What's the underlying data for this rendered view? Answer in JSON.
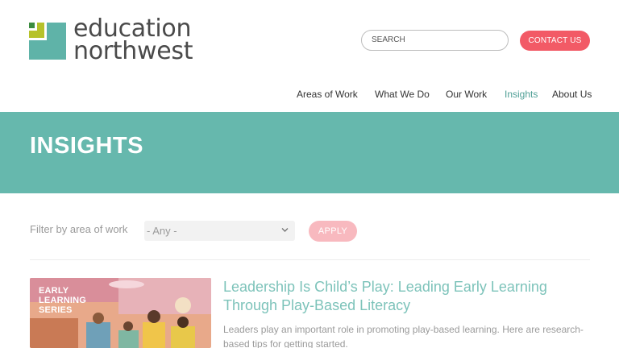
{
  "logo": {
    "line1": "education",
    "line2": "northwest"
  },
  "header": {
    "search_placeholder": "SEARCH",
    "contact_label": "CONTACT US"
  },
  "nav": {
    "items": [
      {
        "label": "Areas of Work"
      },
      {
        "label": "What We Do"
      },
      {
        "label": "Our Work"
      },
      {
        "label": "Insights",
        "active": true
      },
      {
        "label": "About Us"
      }
    ]
  },
  "banner": {
    "title": "INSIGHTS"
  },
  "filter": {
    "label": "Filter by area of work",
    "selected": "- Any -",
    "apply_label": "APPLY"
  },
  "article": {
    "thumb_label_line1": "EARLY",
    "thumb_label_line2": "LEARNING",
    "thumb_label_line3": "SERIES",
    "title": "Leadership Is Child’s Play: Leading Early Learning Through Play-Based Literacy",
    "description": "Leaders play an important role in promoting play-based learning. Here are research-based tips for getting started."
  },
  "colors": {
    "brand_teal": "#66b8ad",
    "accent_red": "#f25a66",
    "logo_green": "#b6c22a",
    "link_teal": "#7dc3ba"
  }
}
